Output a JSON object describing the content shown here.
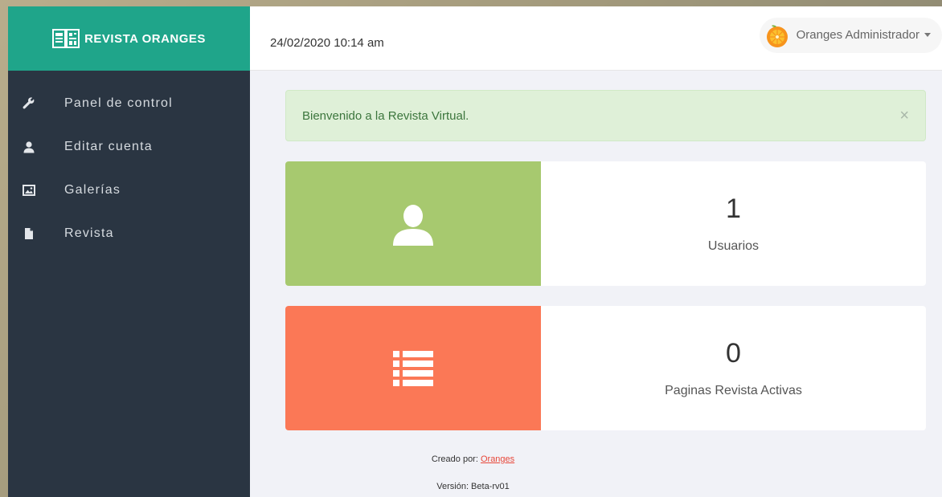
{
  "brand": {
    "title": "REVISTA ORANGES"
  },
  "nav": [
    {
      "label": "Panel de control",
      "icon": "wrench-icon"
    },
    {
      "label": "Editar cuenta",
      "icon": "user-icon"
    },
    {
      "label": "Galerías",
      "icon": "image-icon"
    },
    {
      "label": "Revista",
      "icon": "file-icon"
    }
  ],
  "topbar": {
    "datetime": "24/02/2020 10:14 am",
    "user_name": "Oranges Administrador"
  },
  "alert": {
    "message": "Bienvenido a la Revista Virtual.",
    "close": "×"
  },
  "stats": [
    {
      "value": "1",
      "label": "Usuarios",
      "color": "#a7c96f",
      "icon": "user-icon"
    },
    {
      "value": "0",
      "label": "Paginas Revista Activas",
      "color": "#fb7856",
      "icon": "list-icon"
    }
  ],
  "footer": {
    "created_by": "Creado por:",
    "author_link": "Oranges",
    "version": "Versión: Beta-rv01"
  }
}
